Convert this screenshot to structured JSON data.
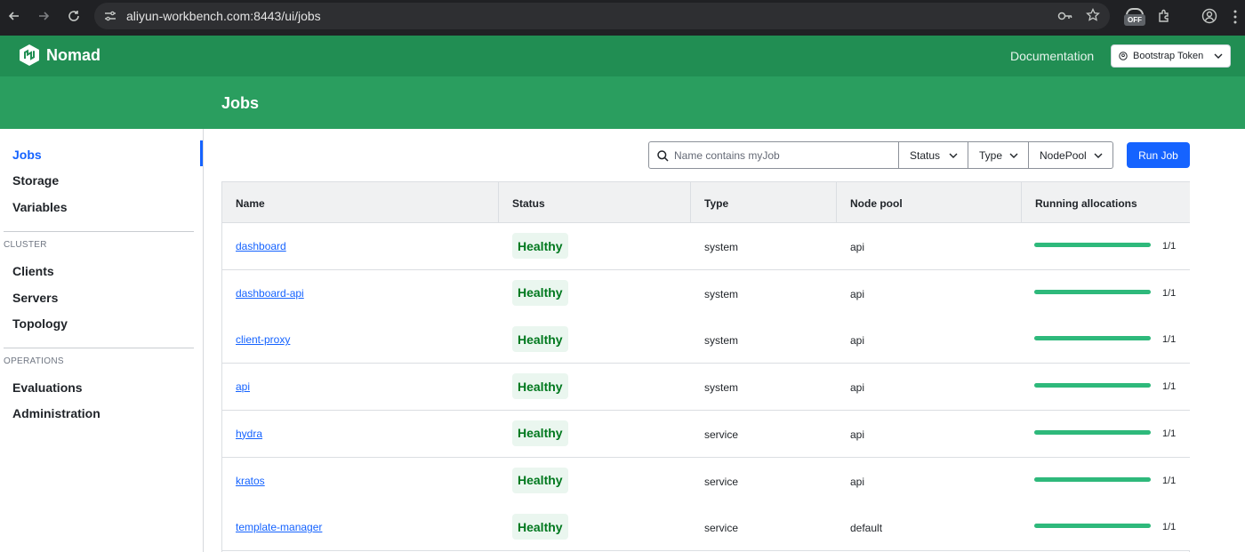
{
  "browser": {
    "url": "aliyun-workbench.com:8443/ui/jobs",
    "ext_badge": "OFF"
  },
  "app": {
    "name": "Nomad",
    "documentation": "Documentation",
    "token_label": "Bootstrap Token",
    "page_title": "Jobs",
    "brand_color": "#218e53",
    "accent_color": "#1563ff"
  },
  "sidebar": {
    "items": [
      {
        "label": "Jobs",
        "active": true
      },
      {
        "label": "Storage"
      },
      {
        "label": "Variables"
      }
    ],
    "cluster_title": "CLUSTER",
    "cluster_items": [
      {
        "label": "Clients"
      },
      {
        "label": "Servers"
      },
      {
        "label": "Topology"
      }
    ],
    "operations_title": "OPERATIONS",
    "operations_items": [
      {
        "label": "Evaluations"
      },
      {
        "label": "Administration"
      }
    ]
  },
  "toolbar": {
    "search_placeholder": "Name contains myJob",
    "filters": [
      "Status",
      "Type",
      "NodePool"
    ],
    "run_job": "Run Job"
  },
  "table": {
    "columns": [
      "Name",
      "Status",
      "Type",
      "Node pool",
      "Running allocations"
    ],
    "rows": [
      {
        "name": "dashboard",
        "status": "Healthy",
        "type": "system",
        "pool": "api",
        "alloc": "1/1",
        "fraction": 1.0
      },
      {
        "name": "dashboard-api",
        "status": "Healthy",
        "type": "system",
        "pool": "api",
        "alloc": "1/1",
        "fraction": 1.0
      },
      {
        "name": "client-proxy",
        "status": "Healthy",
        "type": "system",
        "pool": "api",
        "alloc": "1/1",
        "fraction": 1.0
      },
      {
        "name": "api",
        "status": "Healthy",
        "type": "system",
        "pool": "api",
        "alloc": "1/1",
        "fraction": 1.0
      },
      {
        "name": "hydra",
        "status": "Healthy",
        "type": "service",
        "pool": "api",
        "alloc": "1/1",
        "fraction": 1.0
      },
      {
        "name": "kratos",
        "status": "Healthy",
        "type": "service",
        "pool": "api",
        "alloc": "1/1",
        "fraction": 1.0
      },
      {
        "name": "template-manager",
        "status": "Healthy",
        "type": "service",
        "pool": "default",
        "alloc": "1/1",
        "fraction": 1.0
      }
    ]
  }
}
